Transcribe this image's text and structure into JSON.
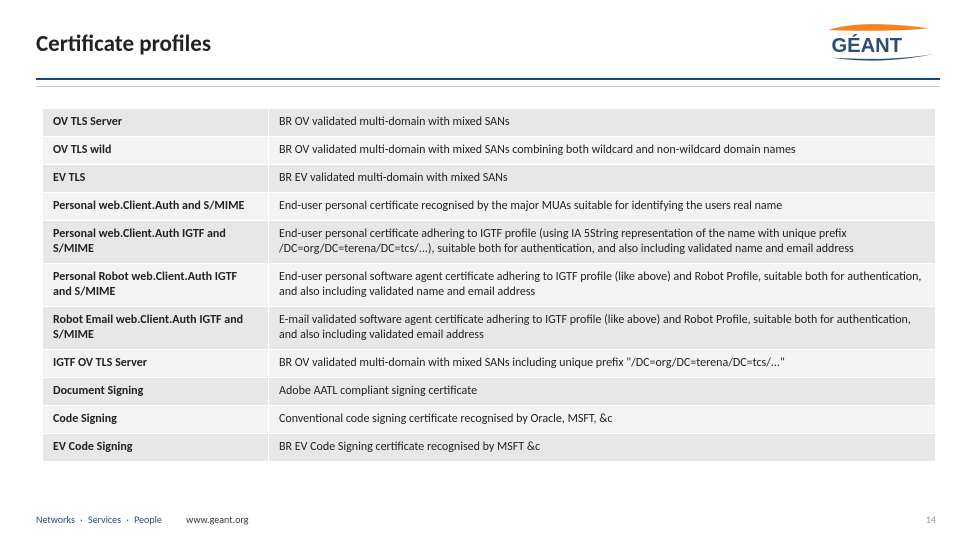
{
  "title": "Certificate profiles",
  "logo_text": "GÉANT",
  "rows": [
    {
      "name": "OV TLS Server",
      "desc": "BR OV validated multi-domain with mixed SANs"
    },
    {
      "name": "OV TLS wild",
      "desc": "BR OV validated multi-domain with mixed SANs combining both wildcard and non-wildcard domain names"
    },
    {
      "name": "EV TLS",
      "desc": "BR EV validated multi-domain with mixed SANs"
    },
    {
      "name": "Personal web.Client.Auth and S/MIME",
      "desc": "End-user personal certificate recognised by the major MUAs suitable for identifying the users real name"
    },
    {
      "name": "Personal web.Client.Auth IGTF and S/MIME",
      "desc": "End-user personal certificate adhering to IGTF profile (using IA 5String representation of the name with unique prefix /DC=org/DC=terena/DC=tcs/...), suitable both for authentication, and also including validated name and email address"
    },
    {
      "name": "Personal Robot web.Client.Auth IGTF and S/MIME",
      "desc": "End-user personal software agent certificate adhering to IGTF profile (like above) and Robot Profile, suitable both for authentication, and also including validated name and email address"
    },
    {
      "name": "Robot Email web.Client.Auth IGTF and S/MIME",
      "desc": "E-mail validated software agent certificate adhering to IGTF profile (like above) and Robot Profile, suitable both for authentication, and also including validated email address"
    },
    {
      "name": "IGTF OV TLS Server",
      "desc": "BR OV validated multi-domain with mixed SANs including unique prefix \"/DC=org/DC=terena/DC=tcs/...\""
    },
    {
      "name": "Document Signing",
      "desc": "Adobe AATL compliant signing certificate"
    },
    {
      "name": "Code Signing",
      "desc": "Conventional code signing certificate recognised by Oracle, MSFT, &c"
    },
    {
      "name": "EV Code Signing",
      "desc": "BR EV Code Signing certificate recognised by MSFT &c"
    }
  ],
  "footer": {
    "segments": [
      "Networks",
      "Services",
      "People"
    ],
    "url": "www.geant.org"
  },
  "page_number": "14"
}
